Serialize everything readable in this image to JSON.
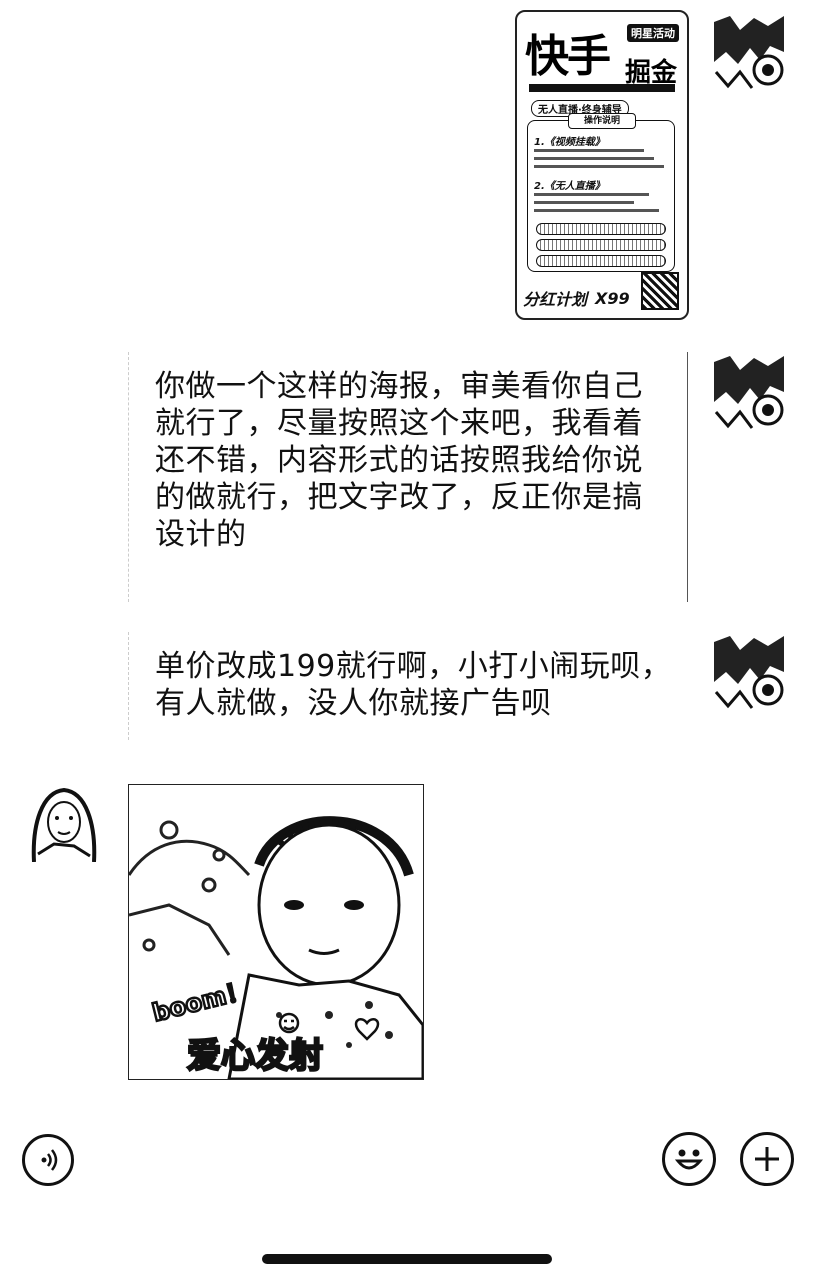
{
  "chat": {
    "poster": {
      "title": "快手",
      "tag": "明星活动",
      "title2": "掘金",
      "pill": "无人直播·终身辅导",
      "section_header": "操作说明",
      "item1": "1.《视频挂载》",
      "item2": "2.《无人直播》",
      "footer_brand": "分红计划",
      "footer_price": "X99"
    },
    "messages": [
      {
        "sender": "other",
        "text": "你做一个这样的海报，审美看你自己就行了，尽量按照这个来吧，我看着还不错，内容形式的话按照我给你说的做就行，把文字改了，反正你是搞设计的"
      },
      {
        "sender": "other",
        "text": "单价改成199就行啊，小打小闹玩呗，有人就做，没人你就接广告呗"
      }
    ],
    "sticker": {
      "caption_top": "boom！",
      "caption_bottom": "爱心发射"
    }
  },
  "input_bar": {
    "voice_icon": "voice-icon",
    "emoji_icon": "emoji-icon",
    "plus_icon": "plus-icon"
  }
}
